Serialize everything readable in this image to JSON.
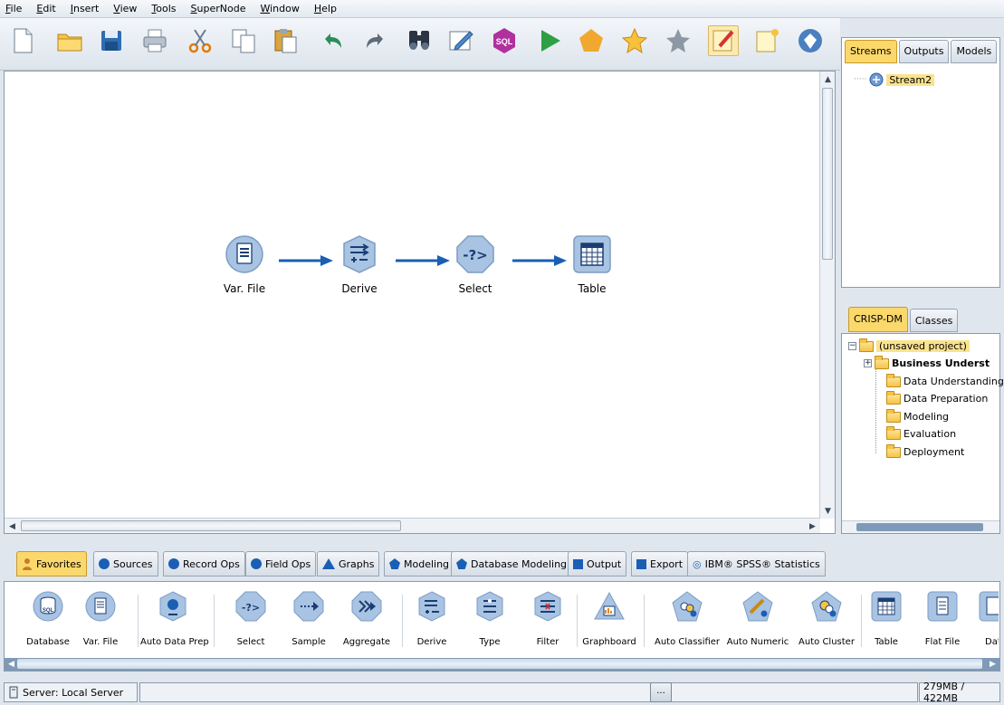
{
  "menu": [
    "File",
    "Edit",
    "Insert",
    "View",
    "Tools",
    "SuperNode",
    "Window",
    "Help"
  ],
  "toolbar_icons": [
    "new-stream-icon",
    "open-folder-icon",
    "save-icon",
    "print-icon",
    "cut-icon",
    "copy-icon",
    "paste-icon",
    "undo-icon",
    "redo-icon",
    "find-icon",
    "edit-icon",
    "sql-icon",
    "run-icon",
    "supernode-icon",
    "favorite-icon",
    "add-favorite-icon",
    "annotation-toggle-icon",
    "comment-icon",
    "diamond-icon"
  ],
  "toolbar_sql_label": "SQL",
  "canvas": {
    "nodes": [
      {
        "label": "Var. File",
        "icon": "var-file-icon"
      },
      {
        "label": "Derive",
        "icon": "derive-icon"
      },
      {
        "label": "Select",
        "icon": "select-icon"
      },
      {
        "label": "Table",
        "icon": "table-icon"
      }
    ]
  },
  "streams_panel": {
    "tabs": [
      "Streams",
      "Outputs",
      "Models"
    ],
    "active_tab": "Streams",
    "items": [
      "Stream2"
    ]
  },
  "project_panel": {
    "tabs": [
      "CRISP-DM",
      "Classes"
    ],
    "active_tab": "CRISP-DM",
    "root": "(unsaved project)",
    "folders": [
      "Business Underst",
      "Data Understanding",
      "Data Preparation",
      "Modeling",
      "Evaluation",
      "Deployment"
    ]
  },
  "palette": {
    "tabs": [
      "Favorites",
      "Sources",
      "Record Ops",
      "Field Ops",
      "Graphs",
      "Modeling",
      "Database Modeling",
      "Output",
      "Export",
      "IBM® SPSS® Statistics"
    ],
    "active_tab": "Favorites",
    "nodes": [
      "Database",
      "Var. File",
      "Auto Data Prep",
      "Select",
      "Sample",
      "Aggregate",
      "Derive",
      "Type",
      "Filter",
      "Graphboard",
      "Auto Classifier",
      "Auto Numeric",
      "Auto Cluster",
      "Table",
      "Flat File",
      "Data"
    ],
    "db_icon_label": "SQL"
  },
  "status": {
    "server": "Server: Local Server",
    "button": "...",
    "memory": "279MB / 422MB"
  },
  "colors": {
    "accent": "#fbd86c",
    "node_fill": "#a9c3e3",
    "arrow": "#1a5fb4"
  }
}
